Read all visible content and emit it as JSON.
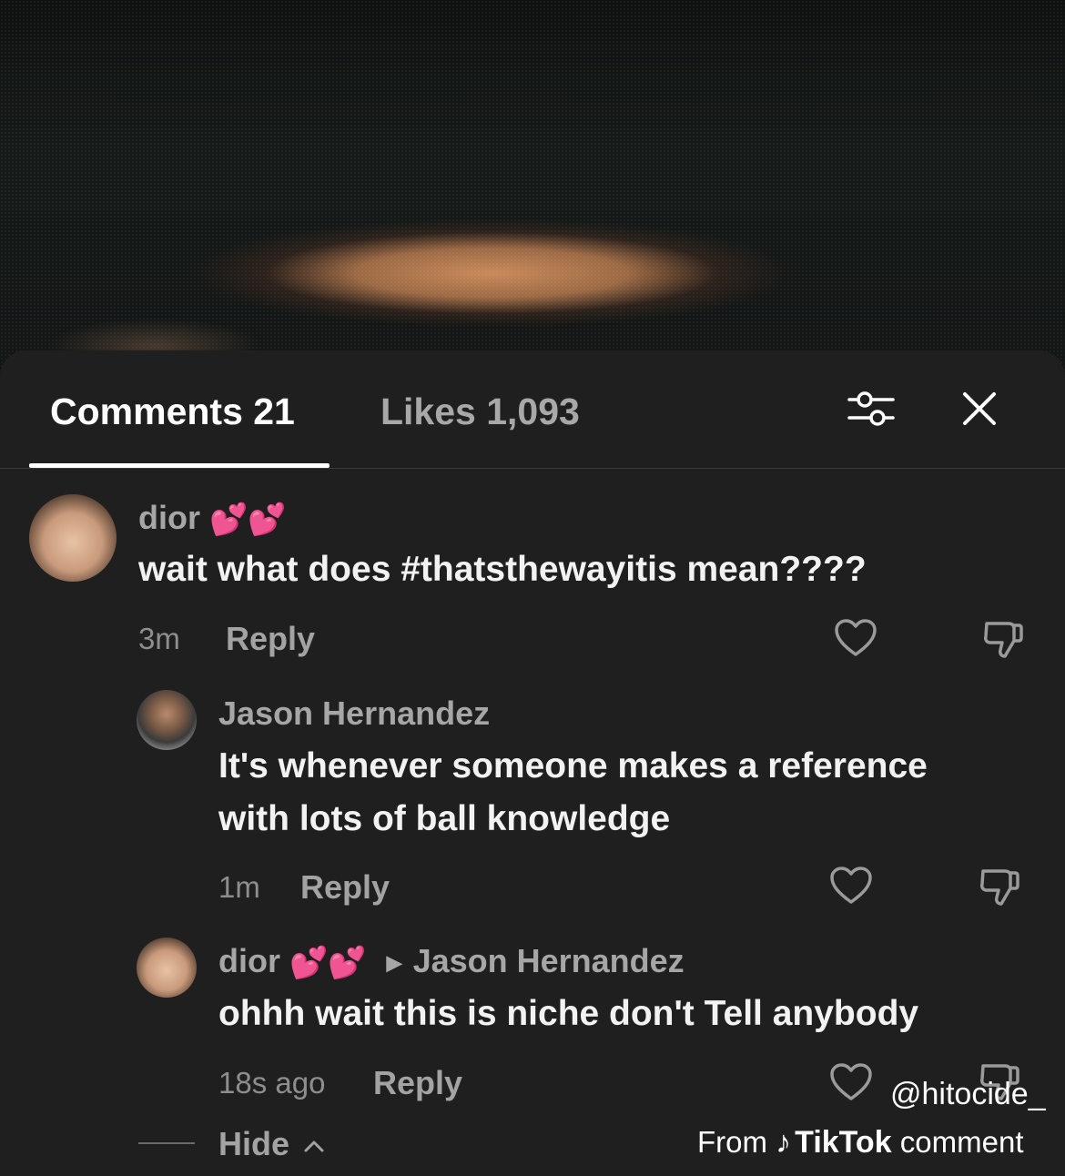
{
  "tabs": {
    "comments_label": "Comments 21",
    "likes_label": "Likes 1,093"
  },
  "icons": {
    "filter": "sliders-icon",
    "close": "close-icon",
    "like": "heart-outline-icon",
    "dislike": "thumbs-down-icon"
  },
  "comments": [
    {
      "username": "dior",
      "emoji": "💕💕",
      "text": "wait what does #thatsthewayitis mean????",
      "time": "3m",
      "reply_label": "Reply"
    }
  ],
  "replies": [
    {
      "username": "Jason Hernandez",
      "text_line1": "It's whenever someone makes a reference",
      "text_line2": "with lots of ball knowledge",
      "time": "1m",
      "reply_label": "Reply"
    },
    {
      "username": "dior",
      "emoji": "💕💕",
      "reply_to": "Jason Hernandez",
      "text": "ohhh wait this is niche don't Tell anybody",
      "time": "18s ago",
      "reply_label": "Reply"
    }
  ],
  "hide_label": "Hide",
  "watermark": {
    "handle": "@hitocide_",
    "from_label": "From",
    "brand": "TikTok",
    "suffix": "comment"
  },
  "colors": {
    "sheet_bg": "#1f1f1f",
    "heart_emoji": "#ff3fa4"
  }
}
